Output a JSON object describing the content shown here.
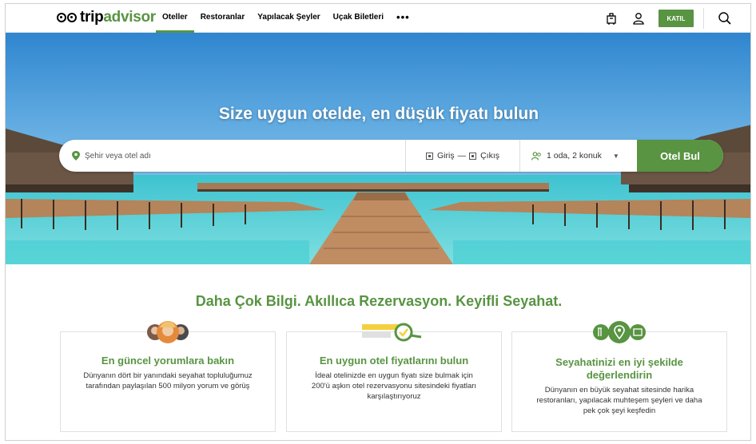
{
  "header": {
    "logo_trip": "trip",
    "logo_advisor": "advisor",
    "nav": [
      "Oteller",
      "Restoranlar",
      "Yapılacak Şeyler",
      "Uçak Biletleri"
    ],
    "nav_more": "•••",
    "join_label": "KATIL",
    "icons": [
      "luggage-icon",
      "user-icon",
      "search-icon"
    ]
  },
  "hero": {
    "title": "Size uygun otelde, en düşük fiyatı bulun",
    "search": {
      "placeholder": "Şehir veya otel adı",
      "checkin": "Giriş",
      "dash": "—",
      "checkout": "Çıkış",
      "guests": "1 oda, 2 konuk",
      "button": "Otel Bul"
    }
  },
  "tagline": "Daha Çok Bilgi. Akıllıca Rezervasyon. Keyifli Seyahat.",
  "cards": [
    {
      "title": "En güncel yorumlara bakın",
      "text": "Dünyanın dört bir yanındaki seyahat topluluğumuz tarafından paylaşılan 500 milyon yorum ve görüş",
      "icon": "avatars-icon"
    },
    {
      "title": "En uygun otel fiyatlarını bulun",
      "text": "İdeal otelinizde en uygun fiyatı size bulmak için 200'ü aşkın otel rezervasyonu sitesindeki fiyatları karşılaştırıyoruz",
      "icon": "price-search-icon"
    },
    {
      "title": "Seyahatinizi en iyi şekilde değerlendirin",
      "text": "Dünyanın en büyük seyahat sitesinde harika restoranları, yapılacak muhteşem şeyleri ve daha pek çok şeyi keşfedin",
      "icon": "places-icon"
    }
  ],
  "colors": {
    "brand_green": "#589442",
    "sea": "#3cc6c9",
    "sky": "#4a9bd6"
  }
}
